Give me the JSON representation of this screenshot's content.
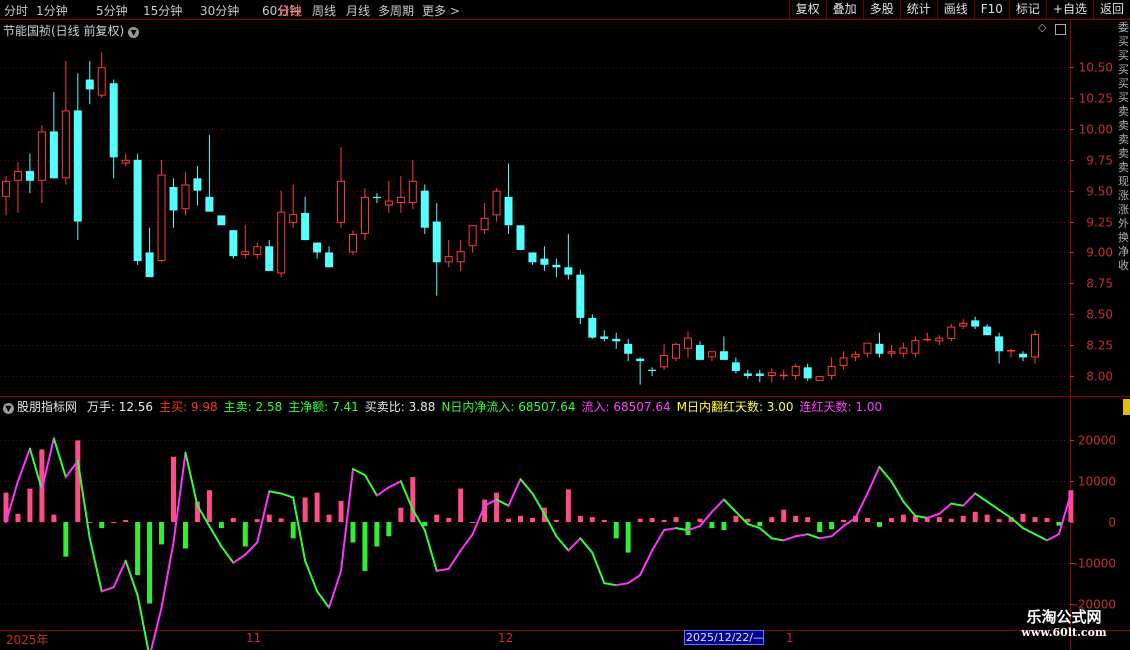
{
  "toolbar": {
    "periods": [
      "分时",
      "1分钟",
      "5分钟",
      "15分钟",
      "30分钟",
      "60分钟",
      "日线",
      "周线",
      "月线",
      "多周期",
      "更多"
    ],
    "active_index": 6,
    "more_arrow": ">",
    "right_buttons": [
      "复权",
      "叠加",
      "多股",
      "统计",
      "画线",
      "F10",
      "标记",
      "+自选",
      "返回"
    ]
  },
  "stock": {
    "title": "节能国祯(日线 前复权)",
    "dropdown_icon": "chevron-down-icon"
  },
  "side_glyphs": [
    "委",
    "买",
    "买",
    "买",
    "买",
    "买",
    "卖",
    "卖",
    "卖",
    "卖",
    "卖",
    "现",
    "涨",
    "涨",
    "外",
    "换",
    "净",
    "收"
  ],
  "indicator": {
    "name": "股朋指标网",
    "items": [
      {
        "label": "万手: 12.56",
        "color": "#e8e8e8"
      },
      {
        "label": "主买: 9.98",
        "color": "#ff3030"
      },
      {
        "label": "主卖: 2.58",
        "color": "#33ff33"
      },
      {
        "label": "主净额: 7.41",
        "color": "#33ff33"
      },
      {
        "label": "买卖比: 3.88",
        "color": "#e8e8e8"
      },
      {
        "label": "N日内净流入: 68507.64",
        "color": "#33ff33"
      },
      {
        "label": "流入: 68507.64",
        "color": "#ff40ff"
      },
      {
        "label": "M日内翻红天数: 3.00",
        "color": "#ffff33"
      },
      {
        "label": "连红天数: 1.00",
        "color": "#ff40ff"
      }
    ]
  },
  "xaxis": {
    "labels": [
      "2025年",
      "11",
      "12",
      "1"
    ],
    "cursor_label": "2025/12/22/—"
  },
  "watermark": {
    "name": "乐淘公式网",
    "url": "www.60lt.com"
  },
  "colors": {
    "up": "#ff3c3c",
    "down": "#54ffff",
    "bar_pos": "#ff4d8c",
    "bar_neg": "#33ee33",
    "line_green": "#33ff33",
    "line_magenta": "#ff33ff"
  },
  "chart_data": [
    {
      "type": "candlestick",
      "ylim": [
        7.87,
        10.72
      ],
      "yticks": [
        8.0,
        8.25,
        8.5,
        8.75,
        9.0,
        9.25,
        9.5,
        9.75,
        10.0,
        10.25,
        10.5
      ],
      "ytick_labels": [
        "8.00",
        "8.25",
        "8.50",
        "8.75",
        "9.00",
        "9.25",
        "9.50",
        "9.75",
        "10.00",
        "10.25",
        "10.50"
      ],
      "grid": "horizontal-dotted",
      "ohlc": [
        [
          9.45,
          9.62,
          9.3,
          9.58
        ],
        [
          9.58,
          9.73,
          9.32,
          9.66
        ],
        [
          9.66,
          9.8,
          9.48,
          9.58
        ],
        [
          9.58,
          10.03,
          9.4,
          9.98
        ],
        [
          9.98,
          10.3,
          9.6,
          9.6
        ],
        [
          9.6,
          10.55,
          9.55,
          10.15
        ],
        [
          10.15,
          10.45,
          9.1,
          9.25
        ],
        [
          10.4,
          10.55,
          10.2,
          10.32
        ],
        [
          10.27,
          10.62,
          10.25,
          10.5
        ],
        [
          10.37,
          10.4,
          9.6,
          9.77
        ],
        [
          9.72,
          9.8,
          9.7,
          9.75
        ],
        [
          9.75,
          9.8,
          8.9,
          8.93
        ],
        [
          9.0,
          9.2,
          8.8,
          8.8
        ],
        [
          8.93,
          9.75,
          8.92,
          9.63
        ],
        [
          9.53,
          9.6,
          9.2,
          9.34
        ],
        [
          9.35,
          9.65,
          9.3,
          9.55
        ],
        [
          9.6,
          9.7,
          9.38,
          9.5
        ],
        [
          9.45,
          9.95,
          9.35,
          9.33
        ],
        [
          9.3,
          9.25,
          9.25,
          9.22
        ],
        [
          9.18,
          9.18,
          8.95,
          8.97
        ],
        [
          8.98,
          9.22,
          8.95,
          9.01
        ],
        [
          8.98,
          9.08,
          8.95,
          9.05
        ],
        [
          9.05,
          9.1,
          8.85,
          8.85
        ],
        [
          8.83,
          9.5,
          8.8,
          9.33
        ],
        [
          9.24,
          9.55,
          9.2,
          9.31
        ],
        [
          9.32,
          9.45,
          9.1,
          9.1
        ],
        [
          9.08,
          9.08,
          8.95,
          9.0
        ],
        [
          9.0,
          9.05,
          8.88,
          8.88
        ],
        [
          9.24,
          9.85,
          9.2,
          9.58
        ],
        [
          9.0,
          9.18,
          8.98,
          9.15
        ],
        [
          9.15,
          9.52,
          9.1,
          9.45
        ],
        [
          9.45,
          9.48,
          9.4,
          9.44
        ],
        [
          9.38,
          9.58,
          9.32,
          9.42
        ],
        [
          9.4,
          9.62,
          9.32,
          9.45
        ],
        [
          9.4,
          9.75,
          9.35,
          9.58
        ],
        [
          9.5,
          9.55,
          9.15,
          9.2
        ],
        [
          9.25,
          9.4,
          8.65,
          8.92
        ],
        [
          8.92,
          9.1,
          8.88,
          8.97
        ],
        [
          8.92,
          9.1,
          8.85,
          9.01
        ],
        [
          9.05,
          9.22,
          9.0,
          9.22
        ],
        [
          9.18,
          9.4,
          9.15,
          9.28
        ],
        [
          9.3,
          9.52,
          9.25,
          9.5
        ],
        [
          9.45,
          9.72,
          9.15,
          9.22
        ],
        [
          9.22,
          9.22,
          9.02,
          9.02
        ],
        [
          9.0,
          8.98,
          8.9,
          8.92
        ],
        [
          8.95,
          9.05,
          8.85,
          8.9
        ],
        [
          8.9,
          8.95,
          8.8,
          8.88
        ],
        [
          8.88,
          9.15,
          8.78,
          8.82
        ],
        [
          8.82,
          8.86,
          8.42,
          8.47
        ],
        [
          8.47,
          8.5,
          8.3,
          8.31
        ],
        [
          8.32,
          8.37,
          8.28,
          8.3
        ],
        [
          8.3,
          8.35,
          8.22,
          8.28
        ],
        [
          8.26,
          8.3,
          8.12,
          8.18
        ],
        [
          8.14,
          8.15,
          7.93,
          8.12
        ],
        [
          8.05,
          8.07,
          8.0,
          8.04
        ],
        [
          8.07,
          8.26,
          8.05,
          8.17
        ],
        [
          8.14,
          8.27,
          8.12,
          8.26
        ],
        [
          8.22,
          8.36,
          8.15,
          8.31
        ],
        [
          8.25,
          8.28,
          8.13,
          8.13
        ],
        [
          8.15,
          8.2,
          8.12,
          8.2
        ],
        [
          8.2,
          8.32,
          8.18,
          8.13
        ],
        [
          8.11,
          8.15,
          8.02,
          8.04
        ],
        [
          8.02,
          8.05,
          7.98,
          8.0
        ],
        [
          8.02,
          8.05,
          7.95,
          8.0
        ],
        [
          8.0,
          8.06,
          7.95,
          8.03
        ],
        [
          8.01,
          8.05,
          7.97,
          8.01
        ],
        [
          8.0,
          8.1,
          7.97,
          8.08
        ],
        [
          8.07,
          8.1,
          7.96,
          7.98
        ],
        [
          7.96,
          8.0,
          7.96,
          8.0
        ],
        [
          8.0,
          8.15,
          7.97,
          8.08
        ],
        [
          8.08,
          8.2,
          8.05,
          8.15
        ],
        [
          8.15,
          8.2,
          8.12,
          8.18
        ],
        [
          8.18,
          8.23,
          8.15,
          8.27
        ],
        [
          8.26,
          8.35,
          8.15,
          8.18
        ],
        [
          8.18,
          8.25,
          8.15,
          8.2
        ],
        [
          8.18,
          8.27,
          8.15,
          8.23
        ],
        [
          8.18,
          8.32,
          8.15,
          8.29
        ],
        [
          8.3,
          8.35,
          8.28,
          8.3
        ],
        [
          8.28,
          8.33,
          8.25,
          8.31
        ],
        [
          8.3,
          8.42,
          8.28,
          8.4
        ],
        [
          8.4,
          8.46,
          8.38,
          8.43
        ],
        [
          8.45,
          8.48,
          8.38,
          8.4
        ],
        [
          8.4,
          8.42,
          8.33,
          8.33
        ],
        [
          8.32,
          8.35,
          8.1,
          8.2
        ],
        [
          8.2,
          8.22,
          8.15,
          8.21
        ],
        [
          8.18,
          8.2,
          8.12,
          8.15
        ],
        [
          8.15,
          8.37,
          8.1,
          8.34
        ]
      ]
    },
    {
      "type": "bar+line",
      "ylim": [
        -26000,
        26000
      ],
      "yticks": [
        20000,
        10000,
        0,
        -10000,
        -20000
      ],
      "ytick_labels": [
        "20000",
        "10000",
        "0",
        "-10000",
        "-20000"
      ],
      "grid": "horizontal-dotted",
      "bars": [
        7200,
        2000,
        8200,
        17800,
        1800,
        -8500,
        20000,
        0,
        -1500,
        0,
        500,
        -13000,
        -20000,
        -5500,
        16000,
        -6500,
        5000,
        7800,
        -1500,
        1000,
        -6000,
        700,
        1800,
        900,
        -4000,
        6000,
        7200,
        1800,
        5200,
        -5000,
        -12000,
        -6000,
        -3500,
        3500,
        11000,
        -1000,
        1800,
        1000,
        8200,
        0,
        5500,
        7200,
        800,
        1500,
        1000,
        3500,
        500,
        8000,
        1500,
        1200,
        500,
        -4000,
        -7500,
        800,
        1000,
        500,
        1200,
        -3200,
        800,
        -1500,
        -2000,
        1500,
        800,
        -1000,
        1200,
        3000,
        1500,
        1200,
        -2500,
        -1800,
        500,
        1500,
        1000,
        -1200,
        1000,
        1800,
        1500,
        1000,
        1200,
        800,
        1500,
        2500,
        1800,
        700,
        1200,
        2000,
        1200,
        1000,
        -900,
        7800
      ],
      "line": [
        0,
        10000,
        18000,
        8000,
        20500,
        11000,
        15000,
        -4000,
        -17000,
        -16000,
        -9500,
        -18000,
        -33000,
        -21000,
        -5000,
        17000,
        4000,
        -1000,
        -6000,
        -10000,
        -8000,
        -5000,
        7500,
        7000,
        6000,
        -9500,
        -17000,
        -21000,
        -12000,
        13000,
        11500,
        6500,
        8500,
        10000,
        3000,
        -2000,
        -12000,
        -11500,
        -7000,
        -3000,
        4000,
        5500,
        4000,
        10500,
        7000,
        2000,
        -3500,
        -7000,
        -4000,
        -7500,
        -15000,
        -15500,
        -15000,
        -13000,
        -7000,
        -2000,
        -1500,
        -2000,
        -1000,
        2500,
        5500,
        2500,
        -500,
        -1500,
        -4000,
        -4500,
        -3500,
        -3000,
        -4000,
        -3500,
        -1000,
        1000,
        7000,
        13500,
        10000,
        5000,
        1500,
        1000,
        2000,
        4500,
        4000,
        7000,
        5000,
        3000,
        1000,
        -1500,
        -3000,
        -4500,
        -3000,
        7000
      ]
    }
  ]
}
